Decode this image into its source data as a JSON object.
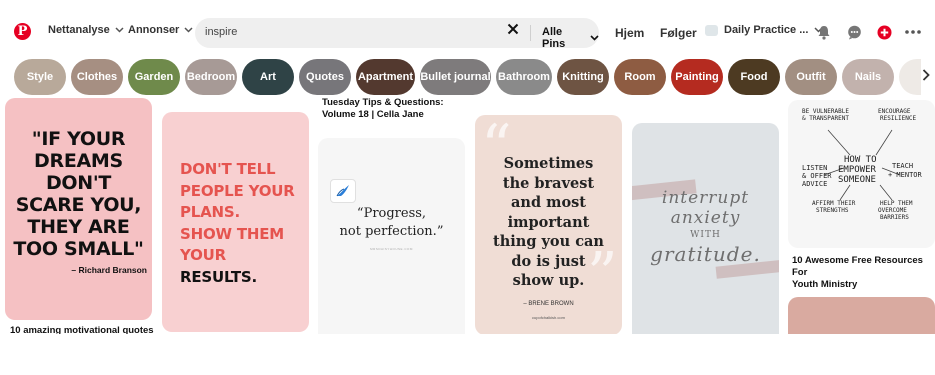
{
  "header": {
    "logo_letter": "P",
    "analytics_label": "Nettanalyse",
    "ads_label": "Annonser",
    "search": {
      "value": "inspire",
      "clear_glyph": "✕",
      "filter_label": "Alle Pins"
    },
    "home_label": "Hjem",
    "following_label": "Følger",
    "account_label": "Daily Practice ...",
    "icons": [
      "bell-icon",
      "chat-icon",
      "create-icon",
      "more-icon"
    ],
    "chevron": "⌄"
  },
  "categories": [
    {
      "label": "Style",
      "color": "#b8a99a"
    },
    {
      "label": "Clothes",
      "color": "#a68f82"
    },
    {
      "label": "Garden",
      "color": "#6f8a4b"
    },
    {
      "label": "Bedroom",
      "color": "#a79a96"
    },
    {
      "label": "Art",
      "color": "#2f4346"
    },
    {
      "label": "Quotes",
      "color": "#77767a"
    },
    {
      "label": "Apartment",
      "color": "#53392f"
    },
    {
      "label": "Bullet journal",
      "color": "#7e7b7c"
    },
    {
      "label": "Bathroom",
      "color": "#8a8a8a"
    },
    {
      "label": "Knitting",
      "color": "#6e5443"
    },
    {
      "label": "Room",
      "color": "#8e5c42"
    },
    {
      "label": "Painting",
      "color": "#b52b20"
    },
    {
      "label": "Food",
      "color": "#4d3a22"
    },
    {
      "label": "Outfit",
      "color": "#a28f82"
    },
    {
      "label": "Nails",
      "color": "#c2b2ad"
    },
    {
      "label": "",
      "color": "#eeeae6"
    }
  ],
  "categories_next": "›",
  "pins": {
    "p1": {
      "line1": "\"IF YOUR",
      "line2": "DREAMS",
      "line3": "DON'T",
      "line4": "SCARE YOU,",
      "line5": "THEY ARE",
      "line6": "TOO SMALL\"",
      "author": "– Richard Branson",
      "caption": "10 amazing motivational quotes"
    },
    "p2": {
      "line1": "DON'T TELL",
      "line2": "PEOPLE YOUR",
      "line3": "PLANS.",
      "line4": "SHOW THEM",
      "line5a": "YOUR ",
      "line5b": "RESULTS."
    },
    "p3": {
      "top_caption_1": "Tuesday Tips & Questions:",
      "top_caption_2": "Volume 18 | Cella Jane",
      "quote1": "“Progress,",
      "quote2": "not perfection.”",
      "small": "MRSDAISYHOUSE.COM"
    },
    "p4": {
      "line1": "Sometimes",
      "line2": "the bravest",
      "line3": "and most",
      "line4": "important",
      "line5": "thing you can",
      "line6": "do is just",
      "line7": "show up.",
      "author": "– BRENE BROWN",
      "site": "cupofchalkish.com"
    },
    "p5": {
      "line1": "interrupt",
      "line2": "anxiety",
      "line3": "WITH",
      "line4": "gratitude."
    },
    "p6": {
      "n1": "BE VULNERABLE",
      "n2": "& TRANSPARENT",
      "n3": "ENCOURAGE",
      "n4": "RESILIENCE",
      "n5": "HOW TO",
      "n6": "EMPOWER",
      "n7": "SOMEONE",
      "n8": "LISTEN",
      "n9": "& OFFER",
      "n10": "ADVICE",
      "n11": "TEACH",
      "n12": "+ MENTOR",
      "n13": "AFFIRM THEIR",
      "n14": "STRENGTHS",
      "n15": "HELP THEM",
      "n16": "OVERCOME",
      "n17": "BARRIERS",
      "caption1": "10 Awesome Free Resources For",
      "caption2": "Youth Ministry"
    }
  }
}
